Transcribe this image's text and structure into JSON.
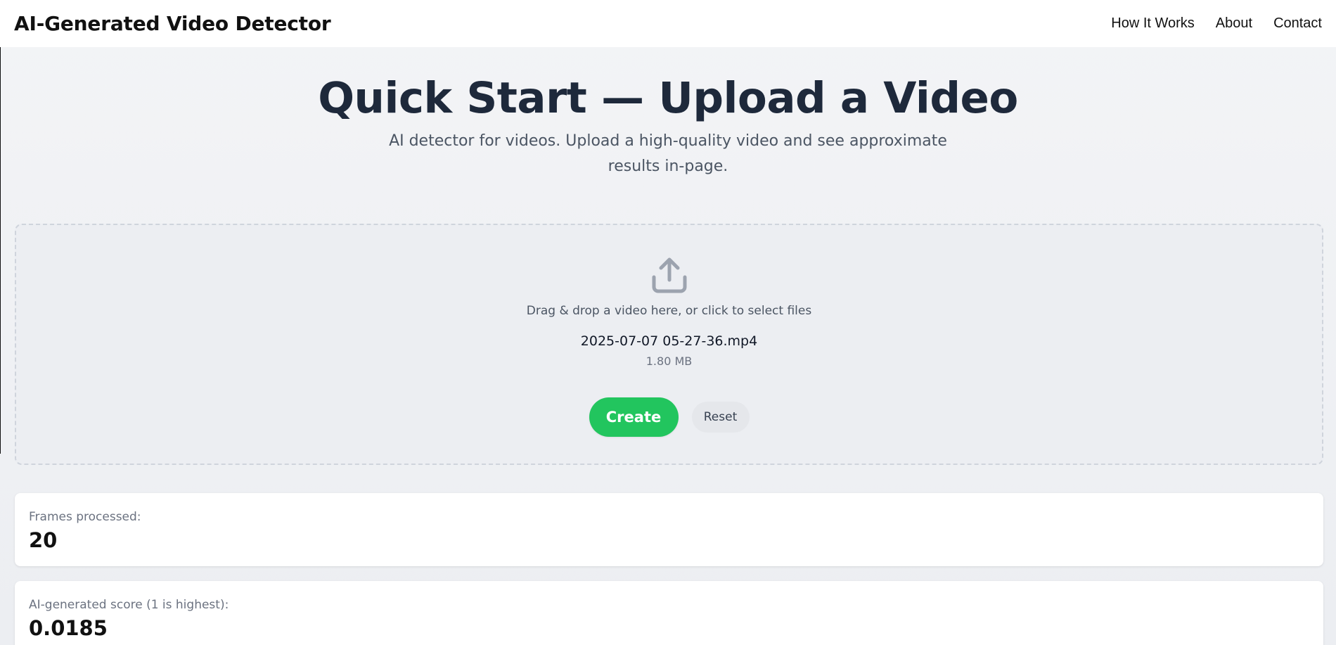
{
  "header": {
    "brand": "AI-Generated Video Detector",
    "nav": [
      {
        "label": "How It Works"
      },
      {
        "label": "About"
      },
      {
        "label": "Contact"
      }
    ]
  },
  "hero": {
    "title": "Quick Start — Upload a Video",
    "subtitle": "AI detector for videos. Upload a high-quality video and see approximate results in-page."
  },
  "dropzone": {
    "icon": "upload-icon",
    "hint": "Drag & drop a video here, or click to select files",
    "file_name": "2025-07-07 05-27-36.mp4",
    "file_size": "1.80 MB",
    "create_label": "Create",
    "reset_label": "Reset"
  },
  "results": {
    "frames_label": "Frames processed:",
    "frames_value": "20",
    "score_label": "AI-generated score (1 is highest):",
    "score_value": "0.0185"
  },
  "colors": {
    "accent_green": "#22c55e",
    "title": "#1e293b",
    "background": "#eceef2"
  }
}
